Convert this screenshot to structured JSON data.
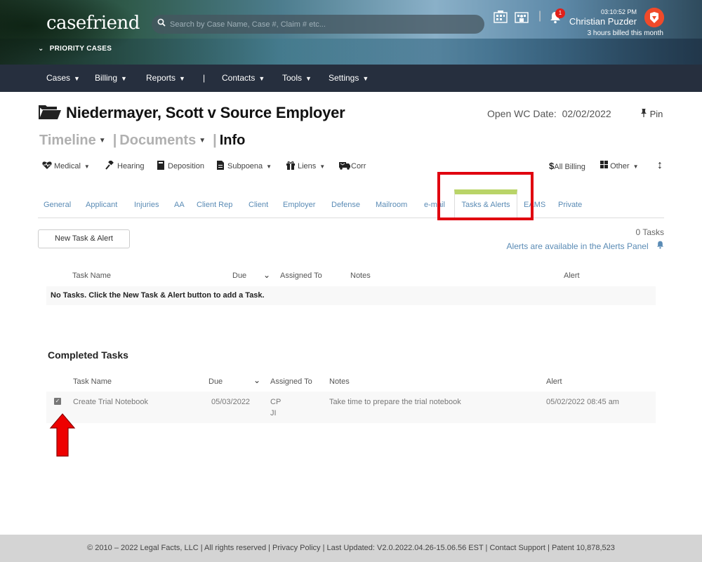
{
  "header": {
    "logo": "casefriend",
    "priority_label": "PRIORITY CASES",
    "search_placeholder": "Search by Case Name, Case #, Claim # etc...",
    "notification_count": "1",
    "time": "03:10:52 PM",
    "user_name": "Christian Puzder",
    "billed": "3 hours billed this month"
  },
  "nav": [
    {
      "label": "Cases"
    },
    {
      "label": "Billing"
    },
    {
      "label": "Reports"
    },
    {
      "label": "|"
    },
    {
      "label": "Contacts"
    },
    {
      "label": "Tools"
    },
    {
      "label": "Settings"
    }
  ],
  "case": {
    "title": "Niedermayer, Scott v Source Employer",
    "open_date_label": "Open WC Date:",
    "open_date": "02/02/2022",
    "pin_label": "Pin"
  },
  "view_tabs": {
    "timeline": "Timeline",
    "documents": "Documents",
    "info": "Info",
    "sep": "|"
  },
  "categories": [
    "Medical",
    "Hearing",
    "Deposition",
    "Subpoena",
    "Liens",
    "Corr"
  ],
  "right_categories": [
    "All Billing",
    "Other"
  ],
  "info_tabs": [
    "General",
    "Applicant",
    "Injuries",
    "AA",
    "Client Rep",
    "Client",
    "Employer",
    "Defense",
    "Mailroom",
    "e-mail",
    "Tasks & Alerts",
    "EAMS",
    "Private"
  ],
  "tasks": {
    "new_button": "New Task & Alert",
    "count": "0 Tasks",
    "alerts_note": "Alerts are available in the Alerts Panel",
    "columns": [
      "Task Name",
      "Due",
      "Assigned To",
      "Notes",
      "Alert"
    ],
    "empty_message": "No Tasks. Click the New Task & Alert button to add a Task."
  },
  "completed": {
    "title": "Completed Tasks",
    "columns": [
      "Task Name",
      "Due",
      "Assigned To",
      "Notes",
      "Alert"
    ],
    "rows": [
      {
        "name": "Create Trial Notebook",
        "due": "05/03/2022",
        "assigned": [
          "CP",
          "JI"
        ],
        "notes": "Take time to prepare the trial notebook",
        "alert": "05/02/2022 08:45 am",
        "checked": true
      }
    ]
  },
  "footer": {
    "copyright": "© 2010 – 2022 Legal Facts, LLC | All rights reserved | ",
    "privacy": "Privacy Policy",
    "updated": " | Last Updated: V2.0.2022.04.26-15.06.56 EST | ",
    "support": "Contact Support",
    "patent": " | Patent 10,878,523"
  },
  "colors": {
    "nav_bg": "#262f3e",
    "link": "#5a8bb5",
    "active_tab_accent": "#b9d468",
    "highlight": "#e0000f"
  }
}
